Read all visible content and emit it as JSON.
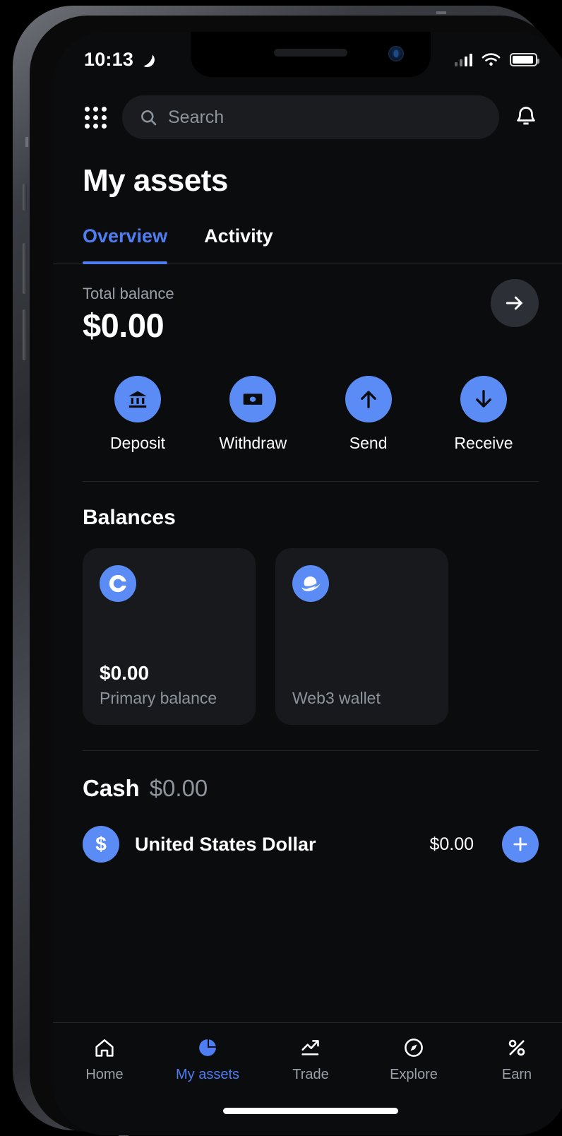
{
  "status_bar": {
    "time": "10:13",
    "dnd_icon": "moon-icon",
    "signal_icon": "cellular-signal-icon",
    "wifi_icon": "wifi-icon",
    "battery_icon": "battery-icon"
  },
  "topbar": {
    "menu_icon": "grid-menu-icon",
    "search_placeholder": "Search",
    "search_value": "",
    "search_icon": "search-icon",
    "notifications_icon": "bell-icon"
  },
  "header": {
    "title": "My assets"
  },
  "tabs": [
    {
      "label": "Overview",
      "active": true
    },
    {
      "label": "Activity",
      "active": false
    }
  ],
  "balance": {
    "label": "Total balance",
    "amount": "$0.00",
    "detail_icon": "arrow-right-icon"
  },
  "actions": [
    {
      "label": "Deposit",
      "icon": "bank-icon"
    },
    {
      "label": "Withdraw",
      "icon": "banknote-icon"
    },
    {
      "label": "Send",
      "icon": "arrow-up-icon"
    },
    {
      "label": "Receive",
      "icon": "arrow-down-icon"
    }
  ],
  "balances": {
    "title": "Balances",
    "cards": [
      {
        "icon": "coinbase-logo-icon",
        "amount": "$0.00",
        "subtitle": "Primary balance"
      },
      {
        "icon": "web3-wallet-icon",
        "amount": "",
        "subtitle": "Web3 wallet"
      }
    ]
  },
  "cash": {
    "title": "Cash",
    "amount": "$0.00",
    "assets": [
      {
        "icon": "dollar-icon",
        "symbol": "$",
        "name": "United States Dollar",
        "value": "$0.00",
        "add_icon": "plus-icon"
      }
    ]
  },
  "bottom_nav": [
    {
      "label": "Home",
      "icon": "home-icon",
      "active": false
    },
    {
      "label": "My assets",
      "icon": "pie-chart-icon",
      "active": true
    },
    {
      "label": "Trade",
      "icon": "trend-up-icon",
      "active": false
    },
    {
      "label": "Explore",
      "icon": "compass-icon",
      "active": false
    },
    {
      "label": "Earn",
      "icon": "percent-icon",
      "active": false
    }
  ],
  "colors": {
    "accent": "#5b8cf5",
    "tab_active": "#4f7df3",
    "background": "#0b0c0e",
    "card": "#17191d",
    "muted_text": "#8e949c"
  }
}
